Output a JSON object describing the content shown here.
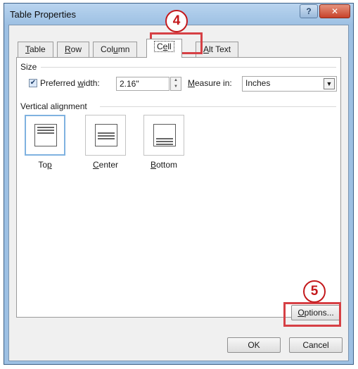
{
  "window": {
    "title": "Table Properties",
    "help_label": "?",
    "close_label": "✕"
  },
  "tabs": [
    {
      "label": "Table",
      "accel": "T",
      "rest": "able"
    },
    {
      "label": "Row",
      "accel": "R",
      "rest": "ow"
    },
    {
      "label": "Column",
      "pre": "Col",
      "accel": "u",
      "rest": "mn"
    },
    {
      "label": "Cell",
      "pre": "C",
      "accel": "e",
      "rest": "ll"
    },
    {
      "label": "Alt Text",
      "accel": "A",
      "rest": "lt Text"
    }
  ],
  "active_tab": "Cell",
  "size": {
    "section_label": "Size",
    "preferred_width_checked": true,
    "preferred_width_pre": "Preferred ",
    "preferred_width_accel": "w",
    "preferred_width_post": "idth:",
    "preferred_width_value": "2.16\"",
    "measure_in_accel": "M",
    "measure_in_post": "easure in:",
    "measure_in_value": "Inches"
  },
  "vertical_alignment": {
    "section_label": "Vertical alignment",
    "selected": "Top",
    "options": [
      {
        "label": "Top",
        "pre": "To",
        "accel": "p",
        "rest": ""
      },
      {
        "label": "Center",
        "pre": "",
        "accel": "C",
        "rest": "enter"
      },
      {
        "label": "Bottom",
        "pre": "",
        "accel": "B",
        "rest": "ottom"
      }
    ]
  },
  "buttons": {
    "options_accel": "O",
    "options_rest": "ptions...",
    "ok_label": "OK",
    "cancel_label": "Cancel"
  },
  "annotations": {
    "step4": "4",
    "step5": "5",
    "color": "#c4191c"
  }
}
